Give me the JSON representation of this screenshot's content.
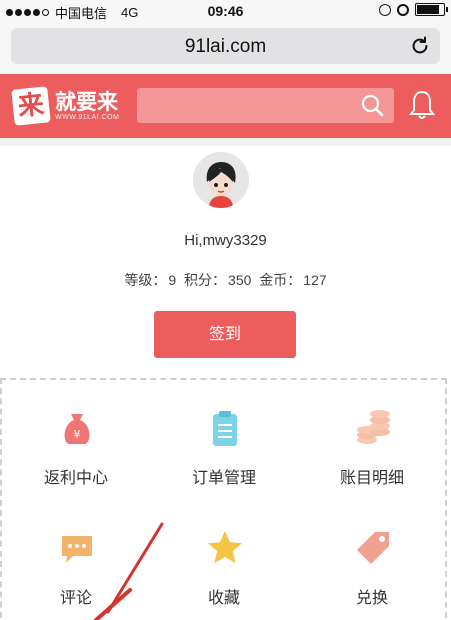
{
  "status_bar": {
    "carrier": "中国电信",
    "network": "4G",
    "time": "09:46"
  },
  "browser": {
    "url": "91lai.com",
    "reload_icon": "reload-icon"
  },
  "header": {
    "logo_char": "来",
    "logo_name": "就要来",
    "logo_url": "WWW.91LAI.COM",
    "search_placeholder": "",
    "search_icon": "search-icon",
    "bell_icon": "bell-icon",
    "accent_color": "#ee5d5e"
  },
  "profile": {
    "greeting": "Hi,mwy3329",
    "level_label": "等级：",
    "level_value": "9",
    "points_label": "积分：",
    "points_value": "350",
    "coins_label": "金币：",
    "coins_value": "127",
    "checkin_label": "签到"
  },
  "menu": {
    "items": [
      {
        "label": "返利中心",
        "icon": "money-bag-icon",
        "color": "#f07575"
      },
      {
        "label": "订单管理",
        "icon": "clipboard-icon",
        "color": "#7fd3e6"
      },
      {
        "label": "账目明细",
        "icon": "coins-icon",
        "color": "#f8c9b1"
      },
      {
        "label": "评论",
        "icon": "comment-icon",
        "color": "#f5b26b"
      },
      {
        "label": "收藏",
        "icon": "star-icon",
        "color": "#f4c542"
      },
      {
        "label": "兑换",
        "icon": "tag-icon",
        "color": "#f2a090"
      }
    ]
  }
}
